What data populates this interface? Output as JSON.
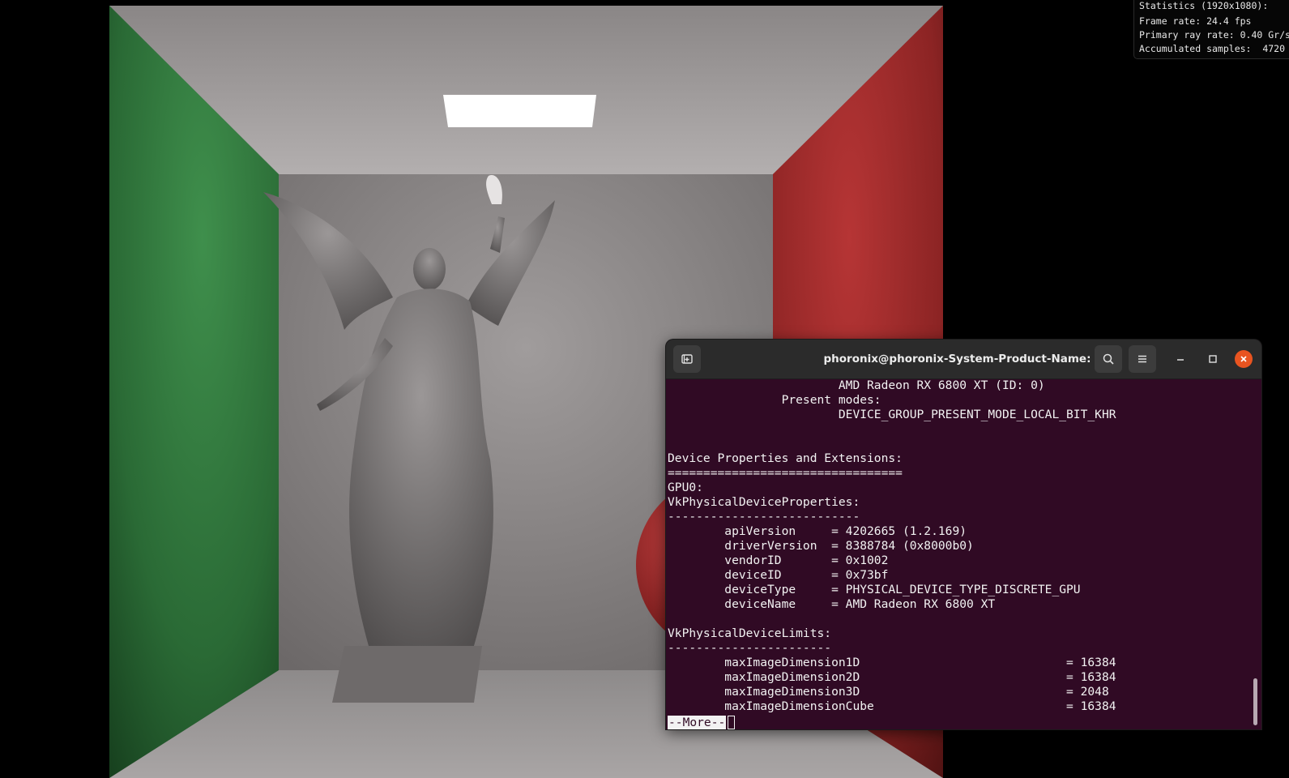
{
  "stats": {
    "lines": [
      "Statistics (1920x1080):",
      "Frame rate: 24.4 fps",
      "Primary ray rate: 0.40 Gr/s",
      "Accumulated samples:  4720"
    ]
  },
  "terminal": {
    "title": "phoronix@phoronix-System-Product-Name: ~",
    "icons": {
      "new_tab": "new-tab-icon",
      "search": "search-icon",
      "menu": "hamburger-menu-icon",
      "minimize": "minimize-icon",
      "maximize": "maximize-icon",
      "close": "close-icon"
    },
    "lines": [
      "                        AMD Radeon RX 6800 XT (ID: 0)",
      "                Present modes:",
      "                        DEVICE_GROUP_PRESENT_MODE_LOCAL_BIT_KHR",
      "",
      "",
      "Device Properties and Extensions:",
      "=================================",
      "GPU0:",
      "VkPhysicalDeviceProperties:",
      "---------------------------",
      "        apiVersion     = 4202665 (1.2.169)",
      "        driverVersion  = 8388784 (0x8000b0)",
      "        vendorID       = 0x1002",
      "        deviceID       = 0x73bf",
      "        deviceType     = PHYSICAL_DEVICE_TYPE_DISCRETE_GPU",
      "        deviceName     = AMD Radeon RX 6800 XT",
      "",
      "VkPhysicalDeviceLimits:",
      "-----------------------",
      "        maxImageDimension1D                             = 16384",
      "        maxImageDimension2D                             = 16384",
      "        maxImageDimension3D                             = 2048",
      "        maxImageDimensionCube                           = 16384"
    ],
    "pager_prompt": "--More--"
  },
  "colors": {
    "terminal_bg": "#300a24",
    "titlebar_bg": "#2b2b2b",
    "close_button": "#e95420",
    "left_wall": "#2f7a3c",
    "right_wall": "#9a2323"
  }
}
